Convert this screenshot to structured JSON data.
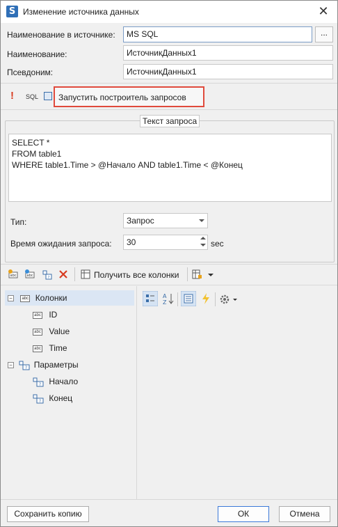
{
  "window": {
    "title": "Изменение источника данных",
    "close_glyph": "✕"
  },
  "form": {
    "source_name_label": "Наименование в источнике:",
    "source_name_value": "MS SQL",
    "browse_label": "...",
    "name_label": "Наименование:",
    "name_value": "ИсточникДанных1",
    "alias_label": "Псевдоним:",
    "alias_value": "ИсточникДанных1"
  },
  "query_toolbar": {
    "warning_glyph": "!",
    "sql_label": "SQL",
    "query_builder_label": "Запустить построитель запросов"
  },
  "query_group": {
    "legend": "Текст запроса",
    "query_text": "SELECT *\nFROM table1\nWHERE table1.Time > @Начало AND table1.Time < @Конец",
    "type_label": "Тип:",
    "type_value": "Запрос",
    "timeout_label": "Время ожидания запроса:",
    "timeout_value": "30",
    "timeout_unit": "sec"
  },
  "columns_toolbar": {
    "get_all_columns_label": "Получить все колонки"
  },
  "tree": {
    "columns_node": "Колонки",
    "columns": [
      "ID",
      "Value",
      "Time"
    ],
    "params_node": "Параметры",
    "params": [
      "Начало",
      "Конец"
    ],
    "expander_glyph": "−"
  },
  "footer": {
    "save_copy_label": "Сохранить копию",
    "ok_label": "ОК",
    "cancel_label": "Отмена"
  },
  "colors": {
    "highlight_border": "#e04a3c",
    "selection": "#dbe6f4",
    "accent_blue": "#2f6fb7"
  }
}
